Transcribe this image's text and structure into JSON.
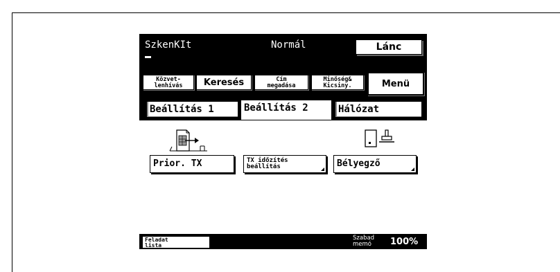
{
  "header": {
    "title": "SzkenKIt",
    "mode": "Normál",
    "chain_button": "Lánc"
  },
  "nav": {
    "items": [
      {
        "label": "Közvet-\nlenhívás"
      },
      {
        "label": "Keresés"
      },
      {
        "label": "Cím\nmegadása"
      },
      {
        "label": "Minőség&\nKicsiny."
      },
      {
        "label": "Menü"
      }
    ]
  },
  "tabs": {
    "items": [
      {
        "label": "Beállítás 1",
        "active": false
      },
      {
        "label": "Beállítás 2",
        "active": true
      },
      {
        "label": "Hálózat",
        "active": false
      }
    ]
  },
  "options": {
    "prior_tx": "Prior. TX",
    "tx_timer": "TX időzítés\nbeállítás",
    "stamp": "Bélyegző"
  },
  "status": {
    "job_list": "Feladat\nlista",
    "free_memory_label": "Szabad\nmemó",
    "free_memory_value": "100%"
  },
  "icons": {
    "prior_tx": "document-send-icon",
    "stamp": "stamp-icon"
  },
  "colors": {
    "screen_background": "#000000",
    "button_background": "#ffffff"
  }
}
